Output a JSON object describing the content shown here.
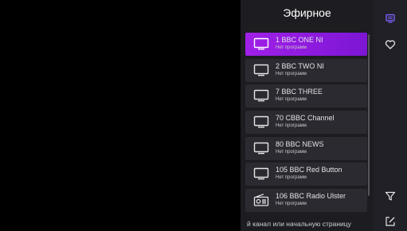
{
  "panel": {
    "title": "Эфирное",
    "channels": [
      {
        "name": "1  BBC ONE NI",
        "sub": "Нет программ",
        "icon": "tv-icon",
        "active": true
      },
      {
        "name": "2  BBC TWO NI",
        "sub": "Нет программ",
        "icon": "tv-icon"
      },
      {
        "name": "7  BBC THREE",
        "sub": "Нет программ",
        "icon": "tv-icon"
      },
      {
        "name": "70  CBBC Channel",
        "sub": "Нет программ",
        "icon": "tv-icon"
      },
      {
        "name": "80  BBC NEWS",
        "sub": "Нет программ",
        "icon": "tv-icon"
      },
      {
        "name": "105  BBC Red Button",
        "sub": "Нет программ",
        "icon": "tv-icon"
      },
      {
        "name": "106  BBC Radio Ulster",
        "sub": "Нет программ",
        "icon": "radio-icon"
      }
    ],
    "footer_text": "й канал или начальную страницу"
  },
  "rail": {
    "items": [
      "channel-list-icon",
      "heart-icon",
      "filter-icon",
      "edit-icon"
    ]
  },
  "colors": {
    "accent": "#8a1ae0",
    "panel_bg": "#1c1c21",
    "item_bg": "#2a2a30",
    "rail_bg": "#202026"
  }
}
